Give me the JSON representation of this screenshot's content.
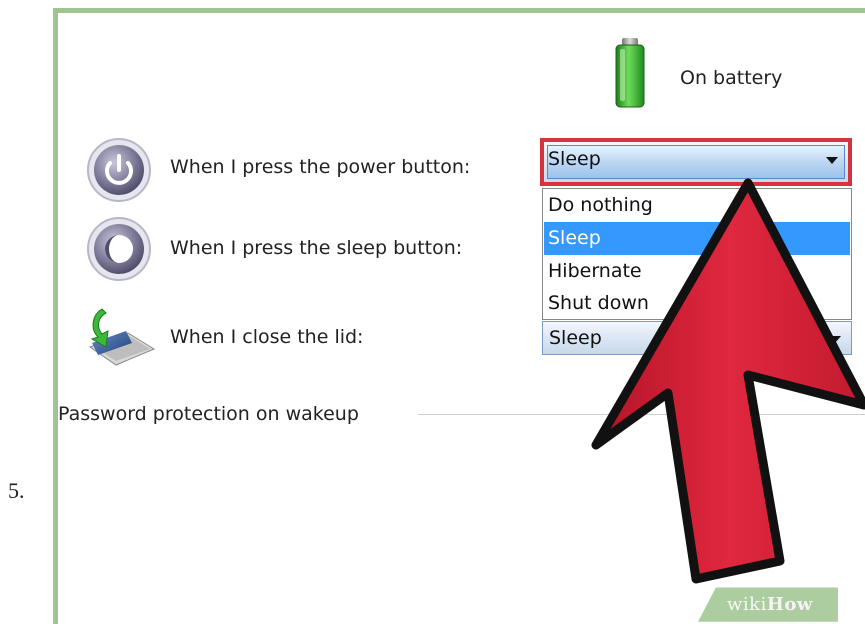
{
  "step": {
    "number": "5."
  },
  "power_plan": {
    "column_header": "On battery",
    "rows": [
      {
        "label": "When I press the power button:",
        "value": "Sleep",
        "icon": "power-icon"
      },
      {
        "label": "When I press the sleep button:",
        "value": "Sleep",
        "icon": "sleep-icon"
      },
      {
        "label": "When I close the lid:",
        "value": "Sleep",
        "icon": "laptop-lid-icon"
      }
    ],
    "open_dropdown": {
      "options": [
        "Do nothing",
        "Sleep",
        "Hibernate",
        "Shut down"
      ],
      "selected": "Sleep"
    },
    "password_section": "Password protection on wakeup"
  },
  "watermark": {
    "wiki": "wiki",
    "how": "How"
  },
  "colors": {
    "frame": "#9ec48f",
    "highlight": "#d63340",
    "selection": "#3399ff",
    "battery": "#2e9b2e"
  }
}
